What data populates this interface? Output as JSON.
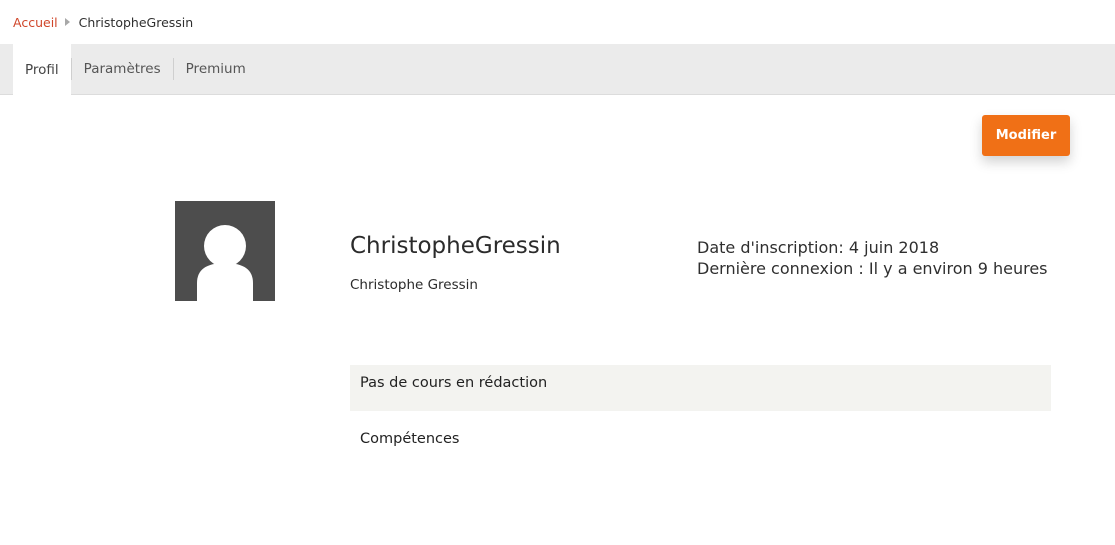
{
  "breadcrumb": {
    "home_label": "Accueil",
    "current_label": "ChristopheGressin"
  },
  "tabs": [
    {
      "label": "Profil",
      "active": true
    },
    {
      "label": "Paramètres",
      "active": false
    },
    {
      "label": "Premium",
      "active": false
    }
  ],
  "actions": {
    "edit_label": "Modifier"
  },
  "profile": {
    "avatar_icon": "default-user-avatar-icon",
    "username": "ChristopheGressin",
    "full_name": "Christophe Gressin",
    "registration": "Date d'inscription: 4 juin 2018",
    "last_login": "Dernière connexion : Il y a environ 9 heures"
  },
  "sections": {
    "courses_label": "Pas de cours en rédaction",
    "skills_label": "Compétences"
  },
  "colors": {
    "accent_link": "#d0462a",
    "button_orange": "#f07016",
    "tab_bar_bg": "#ebebeb",
    "avatar_bg": "#4d4d4d",
    "section_bg": "#f3f3f0"
  }
}
